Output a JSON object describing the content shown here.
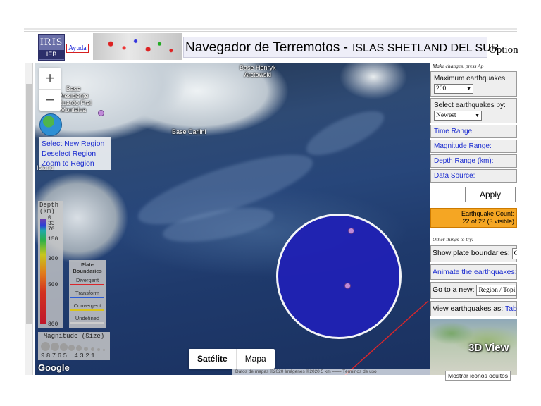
{
  "header": {
    "logo_line1": "IRIS",
    "logo_line2": "IEB",
    "help_link": "Ayuda",
    "title": "Navegador de Terremotos -",
    "region": "ISLAS SHETLAND DEL SUR",
    "options_label": "Option"
  },
  "map": {
    "labels": {
      "base_henryk": "Base Henryk\nArctowski",
      "base_presidente": "Base\nPresidente\nEduardo Frei\nMontalva",
      "base_carlini": "Base Carlini",
      "island": "Island"
    },
    "zoom_in": "+",
    "zoom_out": "−",
    "region_menu": [
      "Select New Region",
      "Deselect Region",
      "Zoom to Region"
    ],
    "depth_legend": {
      "title": "Depth\n(km)",
      "ticks": [
        "0",
        "33",
        "70",
        "150",
        "300",
        "500",
        "800"
      ]
    },
    "plate_legend": {
      "title": "Plate\nBoundaries",
      "items": [
        {
          "label": "Divergent",
          "color": "#d9262b"
        },
        {
          "label": "Transform",
          "color": "#2a5bd6"
        },
        {
          "label": "Convergent",
          "color": "#d8c21a"
        },
        {
          "label": "Undefined",
          "color": "#cccccc"
        }
      ]
    },
    "magnitude_legend": {
      "title": "Magnitude (Size)",
      "numbers": "98765 4321"
    },
    "google_logo": "Google",
    "map_types": {
      "satellite": "Satélite",
      "map": "Mapa"
    },
    "attribution": "Datos de mapas ©2020 Imágenes ©2020   5 km ⎯⎯⎯⎯   Términos de uso"
  },
  "panel": {
    "hint_top": "Make changes, press Ap",
    "max_quakes": {
      "label": "Maximum earthquakes:",
      "value": "200"
    },
    "select_by": {
      "label": "Select earthquakes by:",
      "value": "Newest"
    },
    "time_range": "Time Range:",
    "magnitude_range": "Magnitude Range:",
    "depth_range": "Depth Range (km):",
    "data_source": "Data Source:",
    "apply": "Apply",
    "count_line1": "Earthquake Count:",
    "count_line2": "22 of 22 (3 visible)",
    "other_hint": "Other things to try:",
    "plate_boundaries": {
      "label": "Show plate boundaries:",
      "value": "O"
    },
    "animate": "Animate the earthquakes:",
    "goto": {
      "label": "Go to a new:",
      "value": "Region / Topi"
    },
    "view_as": {
      "label": "View earthquakes as:",
      "value": "Tabl"
    },
    "view3d": "3D View"
  },
  "tooltip": "Mostrar iconos ocultos",
  "colors": {
    "accent_link": "#1a2bd0",
    "count_bg": "#f5a623",
    "selection_circle": "#2021b4",
    "quake_dot": "#c08ad8"
  }
}
